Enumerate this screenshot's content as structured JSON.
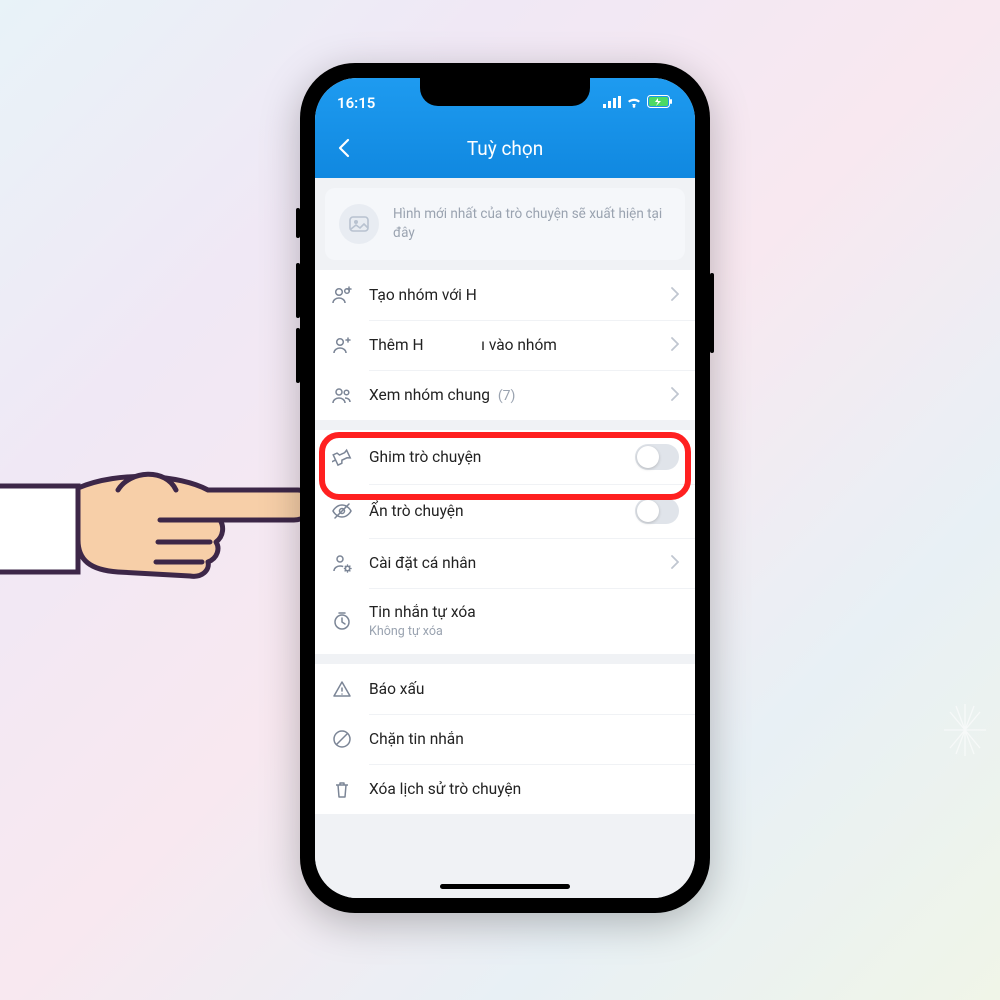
{
  "statusbar": {
    "time": "16:15"
  },
  "header": {
    "title": "Tuỳ chọn"
  },
  "media_placeholder": "Hình mới nhất của trò chuyện sẽ xuất hiện tại đây",
  "group1": {
    "create_group": "Tạo nhóm với H",
    "add_to_group": "Thêm H               ı vào nhóm",
    "shared_groups_label": "Xem nhóm chung",
    "shared_groups_count": "(7)"
  },
  "group2": {
    "pin": "Ghim trò chuyện",
    "hide": "Ẩn trò chuyện",
    "personal_settings": "Cài đặt cá nhân",
    "auto_delete_label": "Tin nhắn tự xóa",
    "auto_delete_sub": "Không tự xóa"
  },
  "group3": {
    "report": "Báo xấu",
    "block": "Chặn tin nhắn",
    "delete_history": "Xóa lịch sử trò chuyện"
  }
}
